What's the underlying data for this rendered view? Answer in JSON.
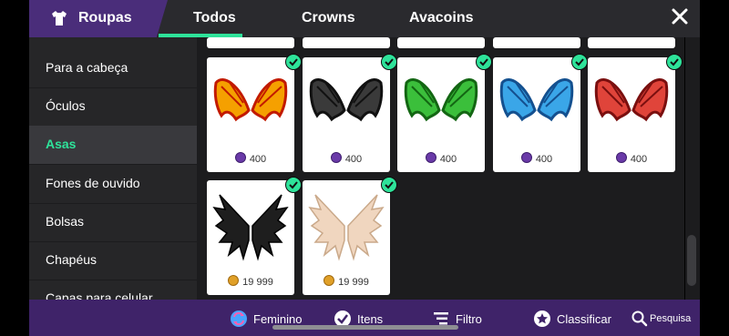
{
  "header": {
    "title": "Roupas",
    "tabs": [
      {
        "label": "Todos",
        "active": true
      },
      {
        "label": "Crowns",
        "active": false
      },
      {
        "label": "Avacoins",
        "active": false
      }
    ]
  },
  "sidebar": {
    "items": [
      {
        "label": "Para a cabeça"
      },
      {
        "label": "Óculos"
      },
      {
        "label": "Asas",
        "active": true
      },
      {
        "label": "Fones de ouvido"
      },
      {
        "label": "Bolsas"
      },
      {
        "label": "Chapéus"
      },
      {
        "label": "Capas para celular"
      }
    ]
  },
  "items": [
    {
      "name": "Asas de dragão de fogo",
      "price": "400",
      "currency": "crown",
      "owned": true,
      "colors": [
        "#f5a000",
        "#c21a00"
      ]
    },
    {
      "name": "Asas de dragão pretas",
      "price": "400",
      "currency": "crown",
      "owned": true,
      "colors": [
        "#3a3a3a",
        "#111111"
      ]
    },
    {
      "name": "Asas de dragão verdes",
      "price": "400",
      "currency": "crown",
      "owned": true,
      "colors": [
        "#3bbf3b",
        "#136613"
      ]
    },
    {
      "name": "Asas de dragão azuis",
      "price": "400",
      "currency": "crown",
      "owned": true,
      "colors": [
        "#3aa6e8",
        "#14508f"
      ]
    },
    {
      "name": "Asas de dragão vermelhas",
      "price": "400",
      "currency": "crown",
      "owned": true,
      "colors": [
        "#e0443a",
        "#7a0f0f"
      ]
    },
    {
      "name": "Asas de penas pretas",
      "price": "19 999",
      "currency": "avacoin",
      "owned": true,
      "colors": [
        "#1e1e1e",
        "#000000"
      ]
    },
    {
      "name": "Asas de penas bege",
      "price": "19 999",
      "currency": "avacoin",
      "owned": true,
      "colors": [
        "#f0d6bf",
        "#caa98a"
      ]
    }
  ],
  "toolbar": {
    "gender_label": "Feminino",
    "items_label": "Itens",
    "filter_label": "Filtro",
    "sort_label": "Classificar",
    "search_label": "Pesquisa"
  },
  "colors": {
    "accent": "#2ee39a",
    "header_tab": "#4a2d7a",
    "bottom_bar": "#3f2369",
    "crown": "#6a3aa8",
    "avacoin": "#e0a028"
  }
}
